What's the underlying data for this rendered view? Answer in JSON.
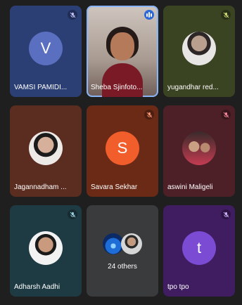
{
  "participants": [
    {
      "name": "VAMSI PAMIDI...",
      "initial": "V",
      "bg": "#2c3f75",
      "avatar_bg": "#5b6fc1"
    },
    {
      "name": "Sheba Sjinfoto...",
      "bg": "#b8a99e"
    },
    {
      "name": "yugandhar red...",
      "bg": "#3a4322"
    },
    {
      "name": "Jagannadham ...",
      "bg": "#5b2c20"
    },
    {
      "name": "Savara Sekhar",
      "initial": "S",
      "bg": "#6a2a16",
      "avatar_bg": "#f25d2c"
    },
    {
      "name": "aswini Maligeli",
      "bg": "#4d2028"
    },
    {
      "name": "Adharsh Aadhi",
      "bg": "#1e3b44"
    },
    {
      "name": "tpo tpo",
      "initial": "t",
      "bg": "#3f1d60",
      "avatar_bg": "#7c4bd4"
    }
  ],
  "others": {
    "label": "24 others"
  },
  "colors": {
    "muted_icon": "#ff6b6b",
    "speaking": "#2d68d8",
    "active_border": "#8ab4f8"
  }
}
